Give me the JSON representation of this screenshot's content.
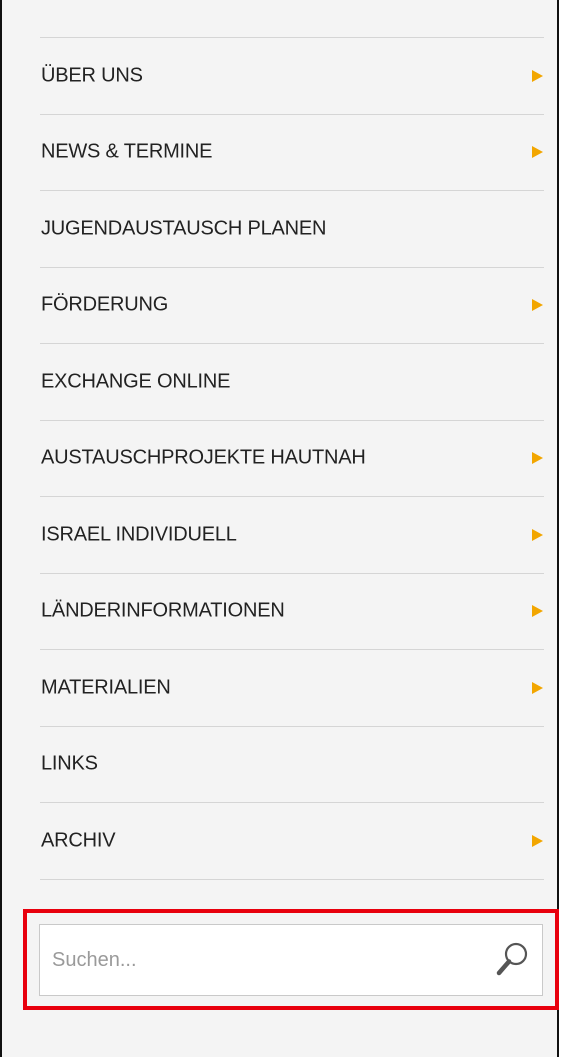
{
  "nav": {
    "items": [
      {
        "label": "ÜBER UNS",
        "has_submenu": true
      },
      {
        "label": "NEWS & TERMINE",
        "has_submenu": true
      },
      {
        "label": "JUGENDAUSTAUSCH PLANEN",
        "has_submenu": false
      },
      {
        "label": "FÖRDERUNG",
        "has_submenu": true
      },
      {
        "label": "EXCHANGE ONLINE",
        "has_submenu": false
      },
      {
        "label": "AUSTAUSCHPROJEKTE HAUTNAH",
        "has_submenu": true
      },
      {
        "label": "ISRAEL INDIVIDUELL",
        "has_submenu": true
      },
      {
        "label": "LÄNDERINFORMATIONEN",
        "has_submenu": true
      },
      {
        "label": "MATERIALIEN",
        "has_submenu": true
      },
      {
        "label": "LINKS",
        "has_submenu": false
      },
      {
        "label": "ARCHIV",
        "has_submenu": true
      }
    ],
    "arrow_icon": "triangle-right-icon"
  },
  "search": {
    "placeholder": "Suchen...",
    "value": "",
    "icon": "magnifier-icon"
  },
  "colors": {
    "background": "#f4f4f4",
    "accent_arrow": "#f2a600",
    "highlight": "#e8000d",
    "text": "#222222",
    "divider": "#d5d5d5"
  }
}
